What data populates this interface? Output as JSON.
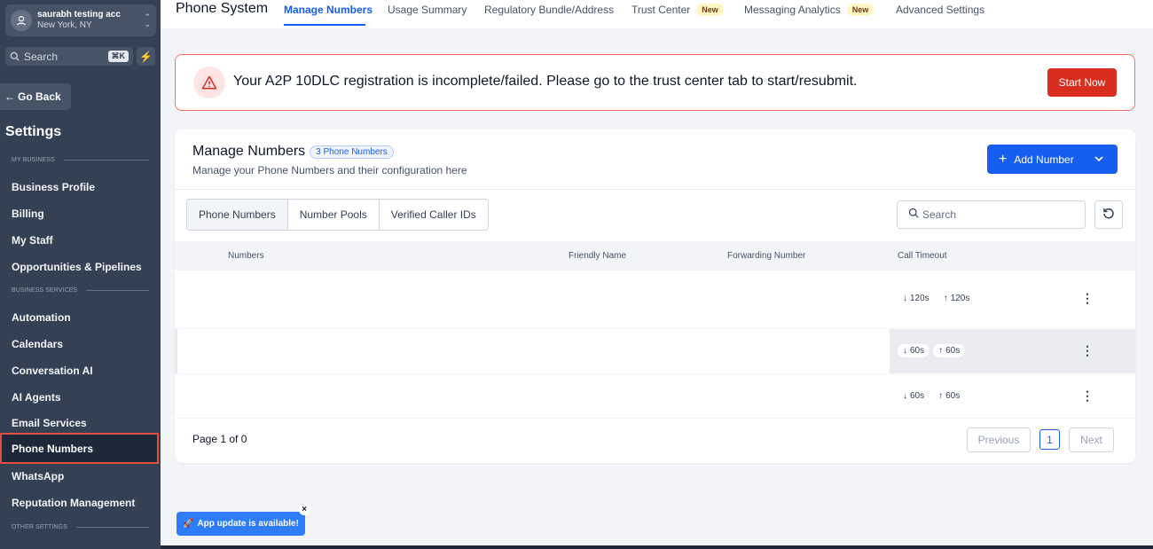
{
  "account": {
    "name": "saurabh testing acc",
    "location": "New York, NY"
  },
  "sidebar": {
    "search_placeholder": "Search",
    "search_shortcut": "⌘K",
    "go_back": "Go Back",
    "title": "Settings",
    "sections": {
      "my_business": "MY BUSINESS",
      "business_services": "BUSINESS SERVICES",
      "other_settings": "OTHER SETTINGS"
    },
    "items": [
      "Business Profile",
      "Billing",
      "My Staff",
      "Opportunities & Pipelines",
      "Automation",
      "Calendars",
      "Conversation AI",
      "AI Agents",
      "Email Services",
      "Phone Numbers",
      "WhatsApp",
      "Reputation Management"
    ],
    "active_item": "Phone Numbers"
  },
  "header": {
    "title": "Phone System",
    "tabs": [
      {
        "label": "Manage Numbers",
        "active": true
      },
      {
        "label": "Usage Summary"
      },
      {
        "label": "Regulatory Bundle/Address"
      },
      {
        "label": "Trust Center",
        "badge": "New"
      },
      {
        "label": "Messaging Analytics",
        "badge": "New"
      },
      {
        "label": "Advanced Settings"
      }
    ]
  },
  "alert": {
    "message": "Your A2P 10DLC registration is incomplete/failed. Please go to the trust center tab to start/resubmit.",
    "button": "Start Now"
  },
  "card": {
    "title": "Manage Numbers",
    "count_badge": "3 Phone Numbers",
    "subtitle": "Manage your Phone Numbers and their configuration here",
    "add_button": "Add Number",
    "segments": [
      "Phone Numbers",
      "Number Pools",
      "Verified Caller IDs"
    ],
    "search_placeholder": "Search"
  },
  "table": {
    "columns": [
      "Numbers",
      "Friendly Name",
      "Forwarding Number",
      "Call Timeout"
    ],
    "rows": [
      {
        "inbound": "120s",
        "outbound": "120s"
      },
      {
        "inbound": "60s",
        "outbound": "60s"
      },
      {
        "inbound": "60s",
        "outbound": "60s"
      }
    ]
  },
  "pagination": {
    "text": "Page 1 of 0",
    "previous": "Previous",
    "current": "1",
    "next": "Next"
  },
  "toast": {
    "text": "App update is available!"
  },
  "colors": {
    "primary": "#155eef",
    "danger": "#d92d20",
    "sidebar": "#344054"
  }
}
